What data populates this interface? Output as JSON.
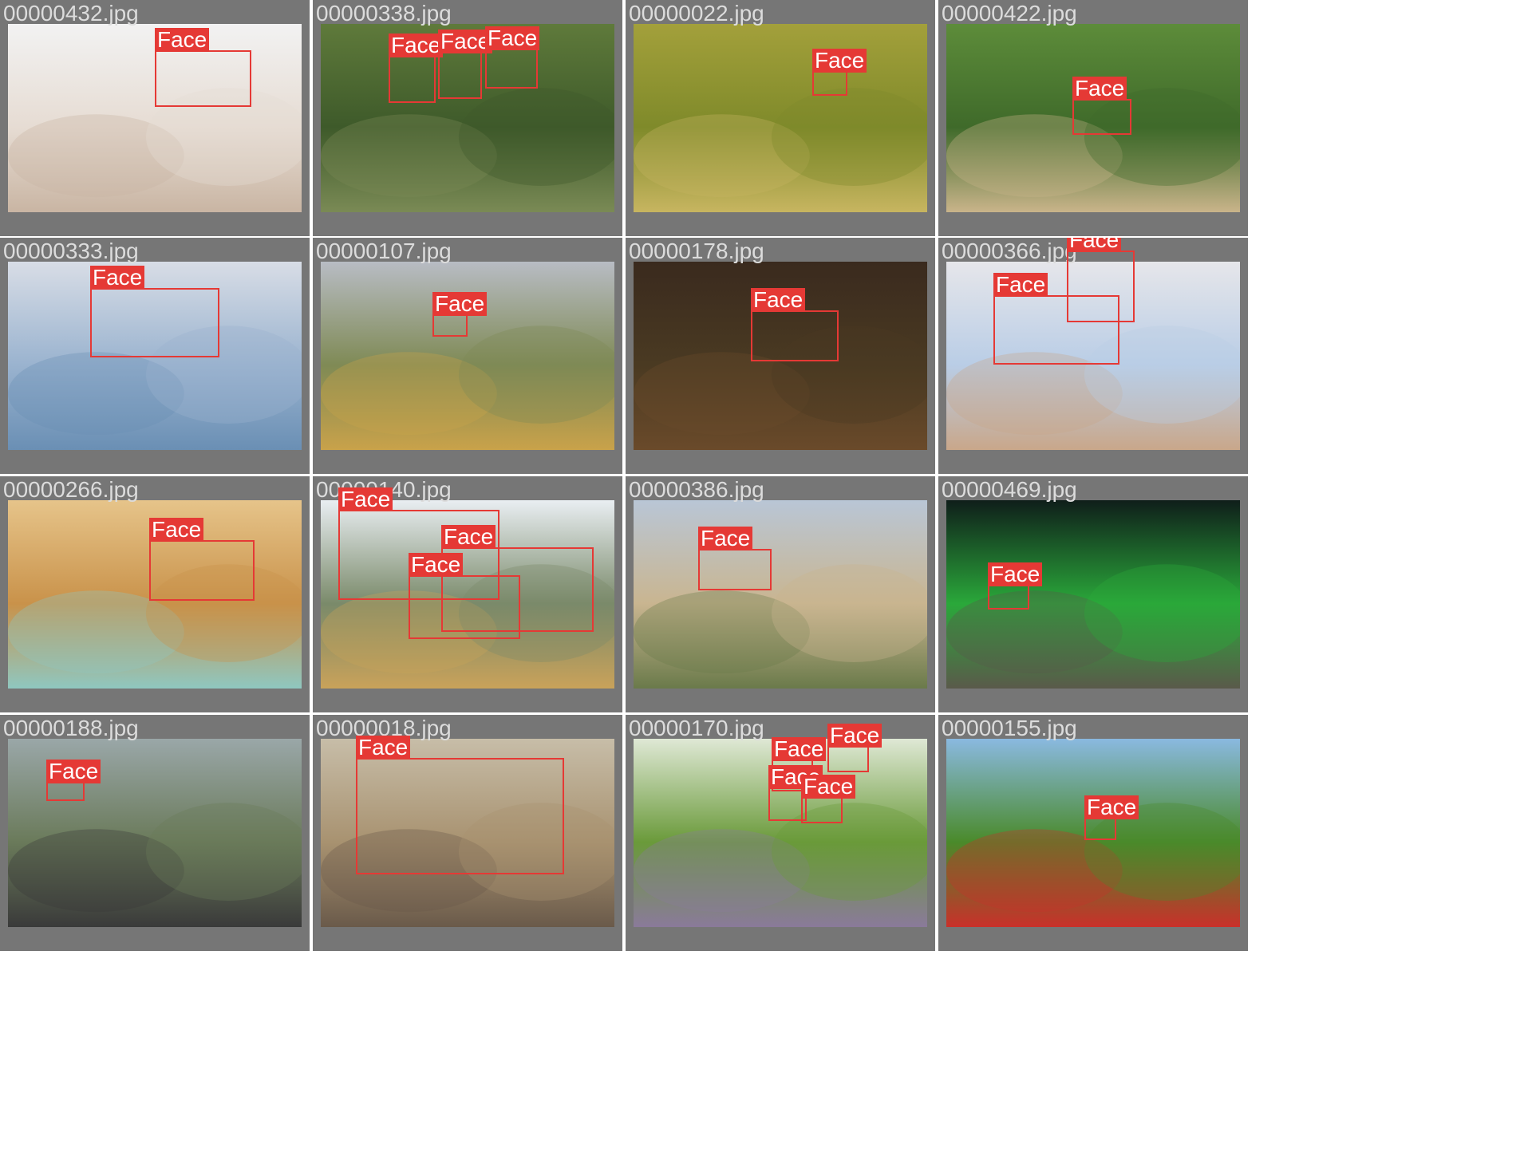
{
  "label_text": "Face",
  "box_color": "#e53935",
  "tiles": [
    {
      "filename": "00000432.jpg",
      "bg": [
        "#f2f2f2",
        "#e6dcd3",
        "#c9b5a3"
      ],
      "faces": [
        [
          0.5,
          0.14,
          0.33,
          0.3
        ]
      ]
    },
    {
      "filename": "00000338.jpg",
      "bg": [
        "#5f7a3b",
        "#3e5a2a",
        "#7a8a55"
      ],
      "faces": [
        [
          0.23,
          0.17,
          0.16,
          0.25
        ],
        [
          0.4,
          0.15,
          0.15,
          0.25
        ],
        [
          0.56,
          0.13,
          0.18,
          0.21
        ]
      ]
    },
    {
      "filename": "00000022.jpg",
      "bg": [
        "#a3a03b",
        "#7f8a2a",
        "#c7b560"
      ],
      "faces": [
        [
          0.61,
          0.25,
          0.12,
          0.13
        ]
      ]
    },
    {
      "filename": "00000422.jpg",
      "bg": [
        "#5d8c3a",
        "#3f6a2a",
        "#c9b48a"
      ],
      "faces": [
        [
          0.43,
          0.4,
          0.2,
          0.19
        ]
      ]
    },
    {
      "filename": "00000333.jpg",
      "bg": [
        "#d8dde6",
        "#9ab3cf",
        "#6a8fb4"
      ],
      "faces": [
        [
          0.28,
          0.14,
          0.44,
          0.37
        ]
      ]
    },
    {
      "filename": "00000107.jpg",
      "bg": [
        "#b8bcc4",
        "#7f8a55",
        "#c9a24a"
      ],
      "faces": [
        [
          0.38,
          0.28,
          0.12,
          0.12
        ]
      ]
    },
    {
      "filename": "00000178.jpg",
      "bg": [
        "#3a2a1e",
        "#4a3a22",
        "#6a4a2a"
      ],
      "faces": [
        [
          0.4,
          0.26,
          0.3,
          0.27
        ]
      ]
    },
    {
      "filename": "00000366.jpg",
      "bg": [
        "#e6e6ea",
        "#b9cde6",
        "#c9a78a"
      ],
      "faces": [
        [
          0.41,
          -0.06,
          0.23,
          0.38
        ],
        [
          0.16,
          0.18,
          0.43,
          0.37
        ]
      ]
    },
    {
      "filename": "00000266.jpg",
      "bg": [
        "#e6c48a",
        "#c9924a",
        "#8fc7c0"
      ],
      "faces": [
        [
          0.48,
          0.21,
          0.36,
          0.32
        ]
      ]
    },
    {
      "filename": "00000140.jpg",
      "bg": [
        "#e9eef2",
        "#7a8a6a",
        "#c9a25a"
      ],
      "faces": [
        [
          0.06,
          0.05,
          0.55,
          0.48
        ],
        [
          0.41,
          0.25,
          0.52,
          0.45
        ],
        [
          0.3,
          0.4,
          0.38,
          0.34
        ]
      ]
    },
    {
      "filename": "00000386.jpg",
      "bg": [
        "#b9c6d6",
        "#c9b590",
        "#6a7a4a"
      ],
      "faces": [
        [
          0.22,
          0.26,
          0.25,
          0.22
        ]
      ]
    },
    {
      "filename": "00000469.jpg",
      "bg": [
        "#0f1e1a",
        "#2aa83a",
        "#5a5a4a"
      ],
      "faces": [
        [
          0.14,
          0.45,
          0.14,
          0.13
        ]
      ]
    },
    {
      "filename": "00000188.jpg",
      "bg": [
        "#9aa7a8",
        "#6a7a5a",
        "#3a3a3a"
      ],
      "faces": [
        [
          0.13,
          0.23,
          0.13,
          0.1
        ]
      ]
    },
    {
      "filename": "00000018.jpg",
      "bg": [
        "#c7bda8",
        "#a89270",
        "#6a5a4a"
      ],
      "faces": [
        [
          0.12,
          0.1,
          0.71,
          0.62
        ]
      ]
    },
    {
      "filename": "00000170.jpg",
      "bg": [
        "#dfe8d5",
        "#6a9a3a",
        "#8a7a9a"
      ],
      "faces": [
        [
          0.47,
          0.11,
          0.14,
          0.17
        ],
        [
          0.66,
          0.04,
          0.14,
          0.14
        ],
        [
          0.46,
          0.26,
          0.13,
          0.18
        ],
        [
          0.57,
          0.31,
          0.14,
          0.14
        ]
      ]
    },
    {
      "filename": "00000155.jpg",
      "bg": [
        "#8ab9e0",
        "#4a8a2a",
        "#c9302a"
      ],
      "faces": [
        [
          0.47,
          0.42,
          0.11,
          0.12
        ]
      ]
    }
  ]
}
